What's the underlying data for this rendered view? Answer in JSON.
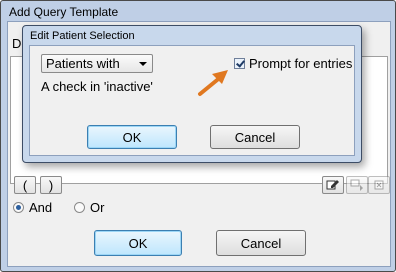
{
  "outer_window": {
    "title": "Add Query Template",
    "description_label": "De",
    "paren_open": "(",
    "paren_close": ")",
    "radio_and": "And",
    "radio_or": "Or",
    "ok_label": "OK",
    "cancel_label": "Cancel"
  },
  "dialog": {
    "title": "Edit Patient Selection",
    "select_value": "Patients with",
    "condition_text": "A check in 'inactive'",
    "checkbox_label": "Prompt for entries",
    "checkbox_checked": true,
    "ok_label": "OK",
    "cancel_label": "Cancel"
  },
  "annotation": {
    "arrow_color": "#e07820"
  }
}
